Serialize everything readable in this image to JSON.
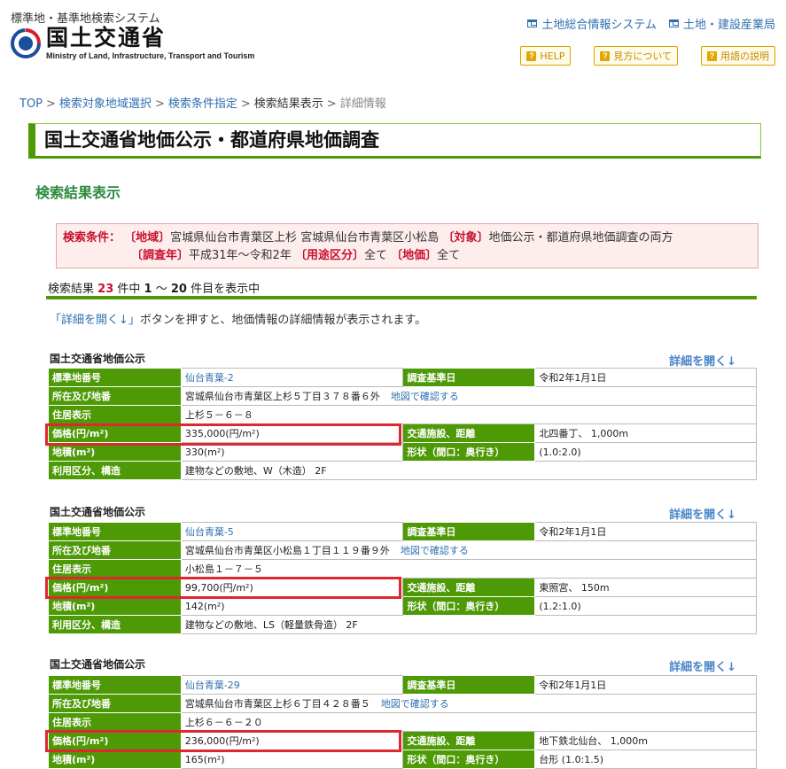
{
  "header": {
    "system_name": "標準地・基準地検索システム",
    "ministry_ja": "国土交通省",
    "ministry_en": "Ministry of Land, Infrastructure, Transport and Tourism",
    "links": [
      "土地総合情報システム",
      "土地・建設産業局"
    ],
    "help_buttons": [
      "HELP",
      "見方について",
      "用語の説明"
    ]
  },
  "breadcrumb": {
    "items": [
      "TOP",
      "検索対象地域選択",
      "検索条件指定",
      "検索結果表示"
    ],
    "current": "詳細情報"
  },
  "page_title": "国土交通省地価公示・都道府県地価調査",
  "section_title": "検索結果表示",
  "conditions": {
    "label": "検索条件：",
    "k_area": "〔地域〕",
    "v_area": "宮城県仙台市青葉区上杉 宮城県仙台市青葉区小松島",
    "k_target": "〔対象〕",
    "v_target": "地価公示・都道府県地価調査の両方",
    "k_year": "〔調査年〕",
    "v_year": "平成31年～令和2年",
    "k_use": "〔用途区分〕",
    "v_use": "全て",
    "k_price": "〔地価〕",
    "v_price": "全て"
  },
  "result_count": {
    "prefix": "検索結果",
    "total": "23",
    "middle": "件中",
    "from": "1",
    "tilde": "～",
    "to": "20",
    "suffix": "件目を表示中"
  },
  "note": {
    "highlight": "「詳細を開く↓」",
    "rest": "ボタンを押すと、地価情報の詳細情報が表示されます。"
  },
  "labels": {
    "point_no": "標準地番号",
    "date": "調査基準日",
    "location": "所在及び地番",
    "map_link": "地図で確認する",
    "address": "住居表示",
    "price": "価格(円/m²)",
    "transport": "交通施設、距離",
    "area": "地積(m²)",
    "shape": "形状（間口：奥行き）",
    "use": "利用区分、構造"
  },
  "entries": [
    {
      "source": "国土交通省地価公示",
      "expand": "詳細を開く↓",
      "point_no": "仙台青葉-2",
      "date": "令和2年1月1日",
      "location": "宮城県仙台市青葉区上杉５丁目３７８番６外",
      "address": "上杉５－６－８",
      "price": "335,000(円/m²)",
      "transport": "北四番丁、 1,000m",
      "area": "330(m²)",
      "shape": "(1.0:2.0)",
      "use": "建物などの敷地、W（木造） 2F"
    },
    {
      "source": "国土交通省地価公示",
      "expand": "詳細を開く↓",
      "point_no": "仙台青葉-5",
      "date": "令和2年1月1日",
      "location": "宮城県仙台市青葉区小松島１丁目１１９番９外",
      "address": "小松島１－７－５",
      "price": "99,700(円/m²)",
      "transport": "東照宮、 150m",
      "area": "142(m²)",
      "shape": "(1.2:1.0)",
      "use": "建物などの敷地、LS（軽量鉄骨造） 2F"
    },
    {
      "source": "国土交通省地価公示",
      "expand": "詳細を開く↓",
      "point_no": "仙台青葉-29",
      "date": "令和2年1月1日",
      "location": "宮城県仙台市青葉区上杉６丁目４２８番５",
      "address": "上杉６－６－２０",
      "price": "236,000(円/m²)",
      "transport": "地下鉄北仙台、 1,000m",
      "area": "165(m²)",
      "shape": "台形 (1.0:1.5)",
      "use": ""
    }
  ],
  "colors": {
    "accent_green": "#4e9a06",
    "link_blue": "#2f6fb0",
    "highlight_red": "#e0262f"
  }
}
